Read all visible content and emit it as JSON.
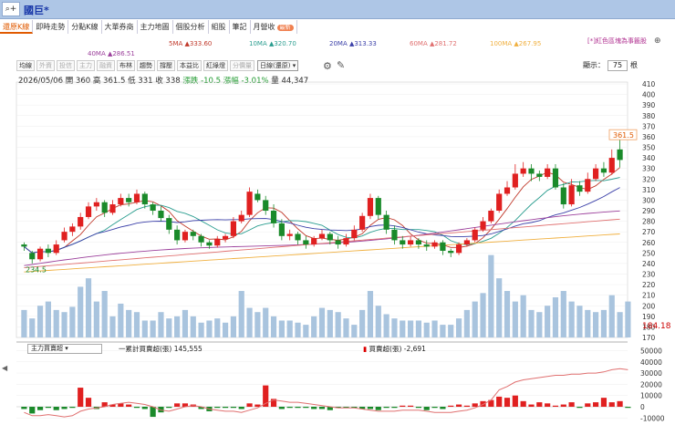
{
  "header": {
    "search_icon": "search-icon",
    "stock_name": "國巨*"
  },
  "tabs": [
    {
      "label": "還原K線",
      "active": true
    },
    {
      "label": "即時走勢"
    },
    {
      "label": "分點K線"
    },
    {
      "label": "大單券商"
    },
    {
      "label": "主力地圖"
    },
    {
      "label": "個股分析"
    },
    {
      "label": "組股"
    },
    {
      "label": "筆記"
    },
    {
      "label": "月營收",
      "badge": "最新"
    }
  ],
  "hint": {
    "text": "[*]紅色區塊為事籤股"
  },
  "ma": {
    "ma5": "5MA ▲333.60",
    "ma10": "10MA ▲320.70",
    "ma20": "20MA ▲313.33",
    "ma60": "60MA ▲281.72",
    "ma100": "100MA ▲267.95",
    "ma40": "40MA ▲286.51",
    "colors": {
      "ma5": "#c0392b",
      "ma10": "#2a9d8f",
      "ma20": "#3a3fa8",
      "ma60": "#e07070",
      "ma100": "#f0b040",
      "ma40": "#9b3f9b"
    }
  },
  "toolbar": {
    "items": [
      {
        "label": "均線",
        "dim": false
      },
      {
        "label": "外資",
        "dim": true
      },
      {
        "label": "投信",
        "dim": true
      },
      {
        "label": "主力",
        "dim": true
      },
      {
        "label": "融資",
        "dim": true
      },
      {
        "label": "布林",
        "dim": false
      },
      {
        "label": "趨勢",
        "dim": false
      },
      {
        "label": "撐壓",
        "dim": false
      },
      {
        "label": "本益比",
        "dim": false
      },
      {
        "label": "紅綠燈",
        "dim": false
      },
      {
        "label": "分價量",
        "dim": true
      }
    ],
    "period_select": "日線(還原)",
    "zoom_label": "顯示：",
    "zoom_value": "75",
    "zoom_unit": "根"
  },
  "quote": {
    "date": "2026/05/06",
    "open": "開 360",
    "high": "高 361.5",
    "low": "低 331",
    "close": "收 338",
    "change": "漲跌 -10.5",
    "pct": "漲幅 -3.01%",
    "volume": "量 44,347"
  },
  "price_axis": [
    "410",
    "400",
    "390",
    "380",
    "370",
    "360",
    "350",
    "340",
    "330",
    "320",
    "310",
    "300",
    "290",
    "280",
    "270",
    "260",
    "250",
    "240",
    "230",
    "220",
    "210",
    "200",
    "190",
    "180",
    "170"
  ],
  "last_price_tag": "361.5",
  "low_tag": "234.5",
  "volume_tag": "184.18",
  "sub": {
    "select": "主力買賣超",
    "legend1": "一累計買賣超(張) 145,555",
    "legend2": "買賣超(張) -2,691",
    "axis": [
      "50000",
      "40000",
      "30000",
      "20000",
      "10000",
      "0",
      "-10000"
    ]
  },
  "chart_data": {
    "type": "candlestick",
    "ylim": [
      170,
      410
    ],
    "candles": [
      [
        258,
        256,
        260,
        252
      ],
      [
        250,
        244,
        252,
        240
      ],
      [
        244,
        254,
        256,
        242
      ],
      [
        254,
        250,
        258,
        246
      ],
      [
        250,
        258,
        262,
        248
      ],
      [
        262,
        270,
        274,
        260
      ],
      [
        270,
        275,
        278,
        266
      ],
      [
        275,
        284,
        288,
        272
      ],
      [
        284,
        294,
        298,
        282
      ],
      [
        294,
        298,
        302,
        290
      ],
      [
        298,
        288,
        300,
        284
      ],
      [
        288,
        296,
        300,
        286
      ],
      [
        296,
        302,
        306,
        294
      ],
      [
        302,
        298,
        306,
        294
      ],
      [
        298,
        306,
        310,
        296
      ],
      [
        306,
        296,
        308,
        292
      ],
      [
        296,
        290,
        298,
        286
      ],
      [
        290,
        283,
        294,
        280
      ],
      [
        283,
        272,
        286,
        268
      ],
      [
        272,
        262,
        276,
        258
      ],
      [
        262,
        270,
        272,
        260
      ],
      [
        270,
        266,
        272,
        262
      ],
      [
        266,
        260,
        268,
        256
      ],
      [
        260,
        257,
        262,
        254
      ],
      [
        257,
        263,
        266,
        255
      ],
      [
        263,
        266,
        268,
        260
      ],
      [
        266,
        280,
        284,
        264
      ],
      [
        280,
        286,
        290,
        278
      ],
      [
        286,
        308,
        312,
        284
      ],
      [
        306,
        300,
        310,
        298
      ],
      [
        300,
        290,
        304,
        286
      ],
      [
        290,
        278,
        296,
        274
      ],
      [
        278,
        266,
        282,
        262
      ],
      [
        266,
        268,
        272,
        262
      ],
      [
        268,
        262,
        270,
        258
      ],
      [
        262,
        258,
        266,
        254
      ],
      [
        258,
        264,
        266,
        256
      ],
      [
        264,
        268,
        272,
        262
      ],
      [
        268,
        262,
        270,
        258
      ],
      [
        262,
        258,
        266,
        254
      ],
      [
        258,
        264,
        268,
        256
      ],
      [
        264,
        272,
        276,
        262
      ],
      [
        272,
        285,
        288,
        270
      ],
      [
        285,
        302,
        306,
        282
      ],
      [
        302,
        286,
        304,
        282
      ],
      [
        286,
        272,
        290,
        268
      ],
      [
        272,
        262,
        276,
        258
      ],
      [
        262,
        258,
        266,
        254
      ],
      [
        258,
        262,
        266,
        256
      ],
      [
        262,
        258,
        264,
        254
      ],
      [
        258,
        256,
        262,
        252
      ],
      [
        256,
        260,
        262,
        254
      ],
      [
        260,
        252,
        262,
        248
      ],
      [
        252,
        250,
        254,
        246
      ],
      [
        250,
        258,
        260,
        248
      ],
      [
        258,
        262,
        264,
        256
      ],
      [
        262,
        272,
        274,
        260
      ],
      [
        272,
        280,
        284,
        270
      ],
      [
        280,
        290,
        292,
        278
      ],
      [
        290,
        306,
        310,
        288
      ],
      [
        306,
        312,
        318,
        304
      ],
      [
        312,
        325,
        334,
        310
      ],
      [
        325,
        330,
        336,
        322
      ],
      [
        330,
        325,
        334,
        318
      ],
      [
        325,
        322,
        328,
        318
      ],
      [
        322,
        330,
        334,
        320
      ],
      [
        330,
        312,
        334,
        310
      ],
      [
        312,
        296,
        316,
        292
      ],
      [
        296,
        314,
        320,
        294
      ],
      [
        314,
        308,
        318,
        304
      ],
      [
        308,
        320,
        326,
        306
      ],
      [
        320,
        330,
        334,
        318
      ],
      [
        330,
        326,
        336,
        322
      ],
      [
        326,
        340,
        348,
        324
      ],
      [
        348,
        338,
        361.5,
        331
      ]
    ],
    "volume": [
      196,
      188,
      200,
      204,
      196,
      194,
      199,
      218,
      226,
      204,
      214,
      190,
      202,
      196,
      194,
      186,
      186,
      194,
      188,
      190,
      196,
      190,
      184,
      186,
      188,
      184,
      190,
      214,
      198,
      194,
      198,
      190,
      186,
      186,
      184,
      182,
      190,
      198,
      196,
      194,
      188,
      182,
      196,
      214,
      200,
      192,
      188,
      186,
      186,
      186,
      184,
      186,
      182,
      182,
      188,
      196,
      204,
      212,
      248,
      226,
      214,
      204,
      210,
      196,
      194,
      200,
      208,
      214,
      204,
      200,
      196,
      194,
      196,
      210,
      194,
      204
    ]
  },
  "sub_data": {
    "bars": [
      -2000,
      -6000,
      -3000,
      -1000,
      -3000,
      -2000,
      -1000,
      17000,
      8000,
      -2000,
      4000,
      2000,
      3000,
      2000,
      -1000,
      -2000,
      -9000,
      -5000,
      -1000,
      3000,
      3000,
      2000,
      -2000,
      -4000,
      -1000,
      -1000,
      -1000,
      -2000,
      3000,
      2000,
      19000,
      7000,
      -2000,
      -1000,
      -1000,
      -1000,
      -2000,
      -2000,
      -3000,
      -1000,
      -1000,
      -1000,
      -2000,
      -2000,
      -3000,
      -1000,
      -1000,
      1000,
      1000,
      -1000,
      -3000,
      -1000,
      -2000,
      1000,
      2000,
      1000,
      3000,
      5000,
      6000,
      9000,
      8000,
      10000,
      5000,
      2000,
      4000,
      3000,
      1000,
      2000,
      4000,
      -1000,
      3000,
      4000,
      8000,
      4000,
      5000,
      -1000
    ],
    "cum": [
      -5000,
      -8000,
      -8000,
      -7000,
      -8000,
      -9000,
      -8000,
      -4000,
      -2000,
      -1000,
      0,
      2000,
      3000,
      4000,
      3000,
      2000,
      0,
      -3000,
      -4000,
      -2000,
      0,
      1000,
      0,
      -2000,
      -3000,
      -4000,
      -4000,
      -5000,
      -3000,
      -1000,
      3000,
      6000,
      5000,
      4000,
      4000,
      3000,
      2000,
      1000,
      0,
      -1000,
      -1000,
      -1000,
      -2000,
      -3000,
      -4000,
      -4000,
      -4000,
      -3000,
      -3000,
      -3000,
      -4000,
      -5000,
      -5000,
      -5000,
      -4000,
      -3000,
      -1000,
      2000,
      6000,
      15000,
      18000,
      22000,
      24000,
      25000,
      26000,
      27000,
      28000,
      28000,
      29000,
      29000,
      30000,
      30000,
      31000,
      33000,
      34000,
      33000
    ],
    "ylim": [
      -13000,
      52000
    ]
  }
}
